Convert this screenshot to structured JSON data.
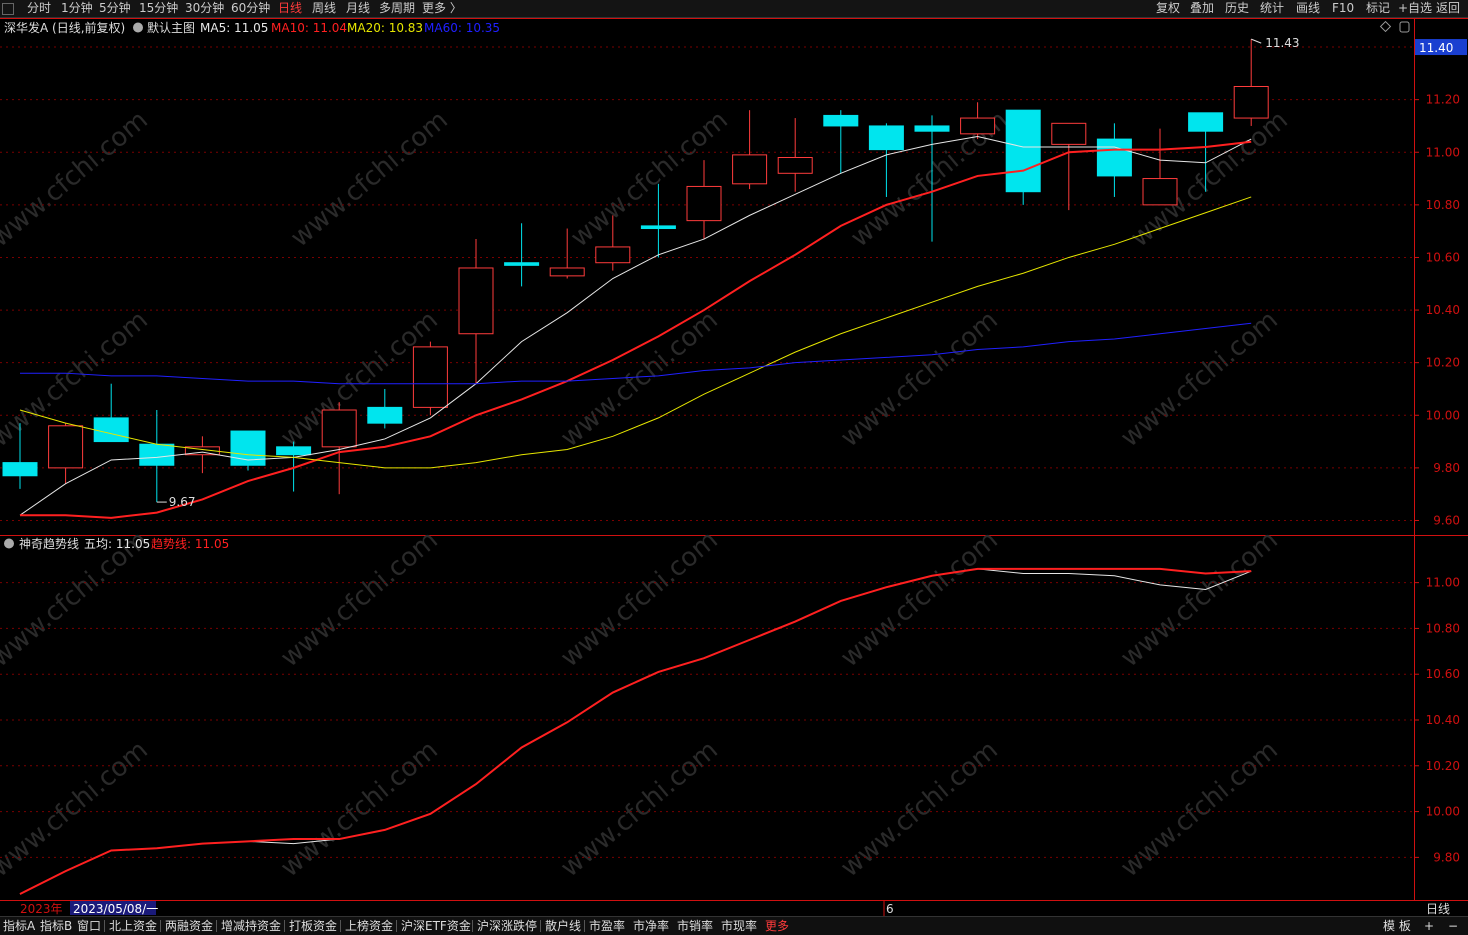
{
  "toolbar": {
    "periods": [
      {
        "label": "分时",
        "active": false
      },
      {
        "label": "1分钟",
        "active": false
      },
      {
        "label": "5分钟",
        "active": false
      },
      {
        "label": "15分钟",
        "active": false
      },
      {
        "label": "30分钟",
        "active": false
      },
      {
        "label": "60分钟",
        "active": false
      },
      {
        "label": "日线",
        "active": true
      },
      {
        "label": "周线",
        "active": false
      },
      {
        "label": "月线",
        "active": false
      },
      {
        "label": "多周期",
        "active": false
      },
      {
        "label": "更多 〉",
        "active": false
      }
    ],
    "right_buttons": [
      "复权",
      "叠加",
      "历史",
      "统计",
      "画线",
      "F10",
      "标记",
      "+自选",
      "返回"
    ]
  },
  "main_header": {
    "stock": "深华发A (日线,前复权)",
    "template": "默认主图",
    "ma5": "MA5: 11.05",
    "ma10": "MA10: 11.04",
    "ma20": "MA20: 10.83",
    "ma60": "MA60: 10.35"
  },
  "price_badge": "11.40",
  "annotations": {
    "high": "11.43",
    "low": "9.67"
  },
  "sub_header": {
    "name": "神奇趋势线",
    "five_avg": "五均: 11.05",
    "trend": "趋势线: 11.05"
  },
  "xaxis": {
    "year_label": "2023年",
    "date_label": "2023/05/08/一",
    "month_label": "6",
    "period_label": "日线"
  },
  "watermark": "www.cfchi.com",
  "colors": {
    "up": "#ff3c3c",
    "down": "#00e5ee",
    "ma5": "#e6e6e6",
    "ma10": "#ff2020",
    "ma20": "#e6e600",
    "ma60": "#2020ff",
    "grid": "#7a0000",
    "axis": "#d01010"
  },
  "chart_data": [
    {
      "type": "candlestick",
      "title": "深华发A (日线,前复权)",
      "ylim": [
        9.56,
        11.48
      ],
      "yticks": [
        9.6,
        9.8,
        10.0,
        10.2,
        10.4,
        10.6,
        10.8,
        11.0,
        11.2,
        11.4
      ],
      "candles": [
        {
          "o": 9.82,
          "h": 9.97,
          "l": 9.72,
          "c": 9.77
        },
        {
          "o": 9.8,
          "h": 9.97,
          "l": 9.74,
          "c": 9.96
        },
        {
          "o": 9.99,
          "h": 10.12,
          "l": 9.9,
          "c": 9.9
        },
        {
          "o": 9.89,
          "h": 10.02,
          "l": 9.67,
          "c": 9.81
        },
        {
          "o": 9.85,
          "h": 9.92,
          "l": 9.78,
          "c": 9.88
        },
        {
          "o": 9.94,
          "h": 9.94,
          "l": 9.79,
          "c": 9.81
        },
        {
          "o": 9.88,
          "h": 9.9,
          "l": 9.71,
          "c": 9.85
        },
        {
          "o": 9.88,
          "h": 10.05,
          "l": 9.7,
          "c": 10.02
        },
        {
          "o": 10.03,
          "h": 10.1,
          "l": 9.95,
          "c": 9.97
        },
        {
          "o": 10.03,
          "h": 10.28,
          "l": 10.0,
          "c": 10.26
        },
        {
          "o": 10.31,
          "h": 10.67,
          "l": 10.12,
          "c": 10.56
        },
        {
          "o": 10.58,
          "h": 10.73,
          "l": 10.49,
          "c": 10.57
        },
        {
          "o": 10.53,
          "h": 10.71,
          "l": 10.52,
          "c": 10.56
        },
        {
          "o": 10.58,
          "h": 10.76,
          "l": 10.55,
          "c": 10.64
        },
        {
          "o": 10.72,
          "h": 10.88,
          "l": 10.6,
          "c": 10.71
        },
        {
          "o": 10.74,
          "h": 10.97,
          "l": 10.67,
          "c": 10.87
        },
        {
          "o": 10.88,
          "h": 11.16,
          "l": 10.86,
          "c": 10.99
        },
        {
          "o": 10.92,
          "h": 11.13,
          "l": 10.85,
          "c": 10.98
        },
        {
          "o": 11.14,
          "h": 11.16,
          "l": 10.92,
          "c": 11.1
        },
        {
          "o": 11.1,
          "h": 11.11,
          "l": 10.83,
          "c": 11.01
        },
        {
          "o": 11.1,
          "h": 11.14,
          "l": 10.66,
          "c": 11.08
        },
        {
          "o": 11.07,
          "h": 11.19,
          "l": 11.05,
          "c": 11.13
        },
        {
          "o": 11.16,
          "h": 11.16,
          "l": 10.8,
          "c": 10.85
        },
        {
          "o": 11.03,
          "h": 11.11,
          "l": 10.78,
          "c": 11.11
        },
        {
          "o": 11.05,
          "h": 11.11,
          "l": 10.83,
          "c": 10.91
        },
        {
          "o": 10.8,
          "h": 11.09,
          "l": 10.8,
          "c": 10.9
        },
        {
          "o": 11.15,
          "h": 11.15,
          "l": 10.85,
          "c": 11.08
        },
        {
          "o": 11.13,
          "h": 11.43,
          "l": 11.1,
          "c": 11.25
        }
      ],
      "series": [
        {
          "name": "MA5",
          "values": [
            9.62,
            9.74,
            9.83,
            9.84,
            9.86,
            9.83,
            9.84,
            9.87,
            9.91,
            9.99,
            10.12,
            10.28,
            10.39,
            10.52,
            10.61,
            10.67,
            10.76,
            10.84,
            10.92,
            10.99,
            11.03,
            11.06,
            11.02,
            11.02,
            11.02,
            10.97,
            10.96,
            11.05
          ]
        },
        {
          "name": "MA10",
          "values": [
            9.62,
            9.62,
            9.61,
            9.63,
            9.68,
            9.75,
            9.8,
            9.86,
            9.88,
            9.92,
            10.0,
            10.06,
            10.13,
            10.21,
            10.3,
            10.4,
            10.51,
            10.61,
            10.72,
            10.8,
            10.85,
            10.91,
            10.93,
            11.0,
            11.01,
            11.01,
            11.02,
            11.04
          ]
        },
        {
          "name": "MA20",
          "values": [
            10.02,
            9.97,
            9.93,
            9.89,
            9.87,
            9.85,
            9.84,
            9.82,
            9.8,
            9.8,
            9.82,
            9.85,
            9.87,
            9.92,
            9.99,
            10.08,
            10.16,
            10.24,
            10.31,
            10.37,
            10.43,
            10.49,
            10.54,
            10.6,
            10.65,
            10.71,
            10.77,
            10.83
          ]
        },
        {
          "name": "MA60",
          "values": [
            10.16,
            10.16,
            10.15,
            10.15,
            10.14,
            10.13,
            10.13,
            10.12,
            10.12,
            10.12,
            10.12,
            10.13,
            10.13,
            10.14,
            10.15,
            10.17,
            10.18,
            10.2,
            10.21,
            10.22,
            10.23,
            10.25,
            10.26,
            10.28,
            10.29,
            10.31,
            10.33,
            10.35
          ]
        }
      ]
    },
    {
      "type": "line",
      "title": "神奇趋势线",
      "ylim": [
        9.64,
        11.16
      ],
      "yticks": [
        9.8,
        10.0,
        10.2,
        10.4,
        10.6,
        10.8,
        11.0
      ],
      "series": [
        {
          "name": "五均",
          "values": [
            9.64,
            9.74,
            9.83,
            9.84,
            9.86,
            9.87,
            9.86,
            9.88,
            9.92,
            9.99,
            10.12,
            10.28,
            10.39,
            10.52,
            10.61,
            10.67,
            10.75,
            10.83,
            10.92,
            10.98,
            11.03,
            11.06,
            11.04,
            11.04,
            11.03,
            10.99,
            10.97,
            11.05
          ]
        },
        {
          "name": "趋势线",
          "values": [
            9.64,
            9.74,
            9.83,
            9.84,
            9.86,
            9.87,
            9.88,
            9.88,
            9.92,
            9.99,
            10.12,
            10.28,
            10.39,
            10.52,
            10.61,
            10.67,
            10.75,
            10.83,
            10.92,
            10.98,
            11.03,
            11.06,
            11.06,
            11.06,
            11.06,
            11.06,
            11.04,
            11.05
          ]
        }
      ]
    }
  ]
}
